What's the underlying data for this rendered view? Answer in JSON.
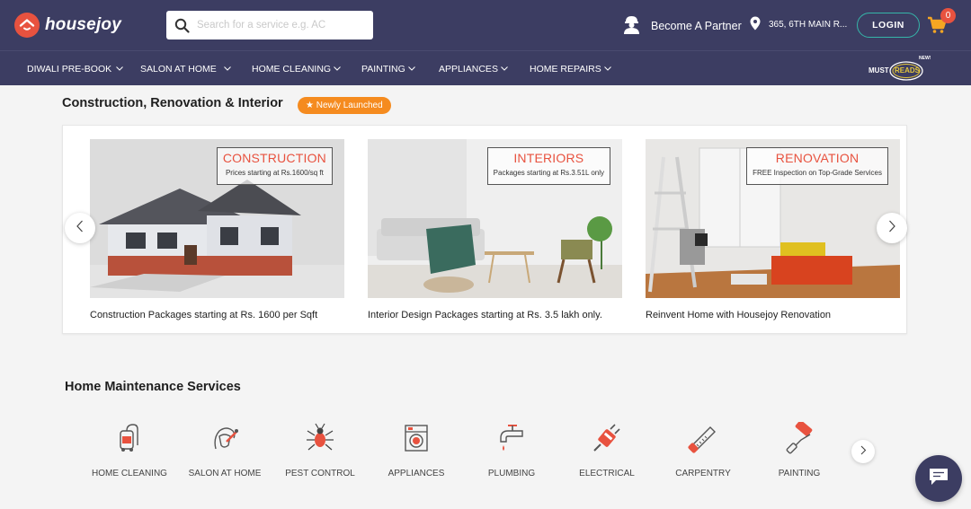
{
  "header": {
    "brand": "housejoy",
    "search_placeholder": "Search for a service e.g. AC",
    "partner_label": "Become A Partner",
    "location_label": "365, 6TH MAIN R...",
    "login_label": "LOGIN",
    "cart_count": "0",
    "icons": {
      "logo": "house-logo-icon",
      "search": "search-icon",
      "partner": "worker-icon",
      "location": "location-pin-icon",
      "cart": "cart-icon"
    }
  },
  "nav": {
    "items": [
      "DIWALI PRE-BOOK",
      "SALON AT HOME",
      "HOME CLEANING",
      "PAINTING",
      "APPLIANCES",
      "HOME REPAIRS"
    ],
    "must_reads_left": "MUST",
    "must_reads_right": "READS",
    "must_reads_tag": "NEW!"
  },
  "construction_section": {
    "title": "Construction, Renovation & Interior",
    "badge": "★ Newly Launched",
    "cards": [
      {
        "overlay_title": "CONSTRUCTION",
        "overlay_sub": "Prices starting at Rs.1600/sq ft",
        "caption": "Construction Packages starting at Rs. 1600 per Sqft"
      },
      {
        "overlay_title": "INTERIORS",
        "overlay_sub": "Packages starting at Rs.3.51L only",
        "caption": "Interior Design Packages starting at Rs. 3.5 lakh only."
      },
      {
        "overlay_title": "RENOVATION",
        "overlay_sub": "FREE Inspection on Top-Grade Services",
        "caption": "Reinvent Home with Housejoy Renovation"
      }
    ]
  },
  "maintenance_section": {
    "title": "Home Maintenance Services",
    "services": [
      {
        "label": "HOME CLEANING",
        "icon": "vacuum-icon"
      },
      {
        "label": "SALON AT HOME",
        "icon": "salon-icon"
      },
      {
        "label": "PEST CONTROL",
        "icon": "bug-icon"
      },
      {
        "label": "APPLIANCES",
        "icon": "washing-machine-icon"
      },
      {
        "label": "PLUMBING",
        "icon": "tap-icon"
      },
      {
        "label": "ELECTRICAL",
        "icon": "plug-icon"
      },
      {
        "label": "CARPENTRY",
        "icon": "saw-icon"
      },
      {
        "label": "PAINTING",
        "icon": "paint-roller-icon"
      }
    ]
  },
  "colors": {
    "header_bg": "#3c3d62",
    "accent": "#e8523f",
    "badge": "#f58b1f",
    "login_border": "#35b5a9",
    "cart": "#f5a623"
  }
}
